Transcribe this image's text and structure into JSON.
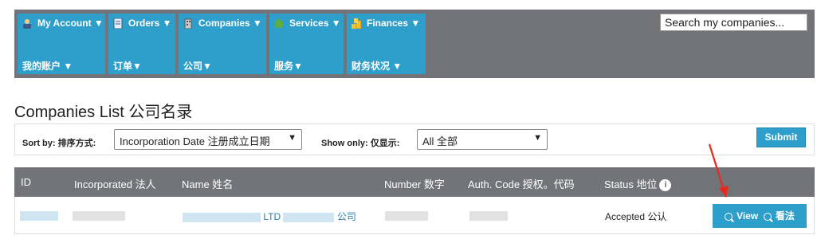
{
  "nav": {
    "menus": [
      {
        "label": "My Account ▼",
        "sublabel": "我的账户 ▼",
        "icon": "user-icon"
      },
      {
        "label": "Orders ▼",
        "sublabel": "订单▼",
        "icon": "document-icon"
      },
      {
        "label": "Companies ▼",
        "sublabel": "公司▼",
        "icon": "building-icon"
      },
      {
        "label": "Services ▼",
        "sublabel": "服务▼",
        "icon": "puzzle-icon"
      },
      {
        "label": "Finances ▼",
        "sublabel": "财务状况 ▼",
        "icon": "coins-icon"
      }
    ],
    "search_placeholder": "Search my companies..."
  },
  "page": {
    "title": "Companies List 公司名录"
  },
  "filters": {
    "sort_label": "Sort by:  排序方式:",
    "sort_value": "Incorporation Date 注册成立日期",
    "show_label": "Show only:  仅显示:",
    "show_value": "All 全部",
    "submit_label": "Submit"
  },
  "table": {
    "headers": [
      "ID",
      "Incorporated 法人",
      "Name 姓名",
      "Number 数字",
      "Auth. Code 授权。代码",
      "Status  地位"
    ],
    "rows": [
      {
        "name_visible_1": "LTD",
        "name_visible_2": "公司",
        "status": "Accepted 公认",
        "view_label": "View",
        "view_label_cn": "看法"
      }
    ]
  },
  "colors": {
    "nav_bg": "#727479",
    "accent": "#2e9fcb",
    "link": "#2a7fb0",
    "annotation_arrow": "#e8291c"
  }
}
